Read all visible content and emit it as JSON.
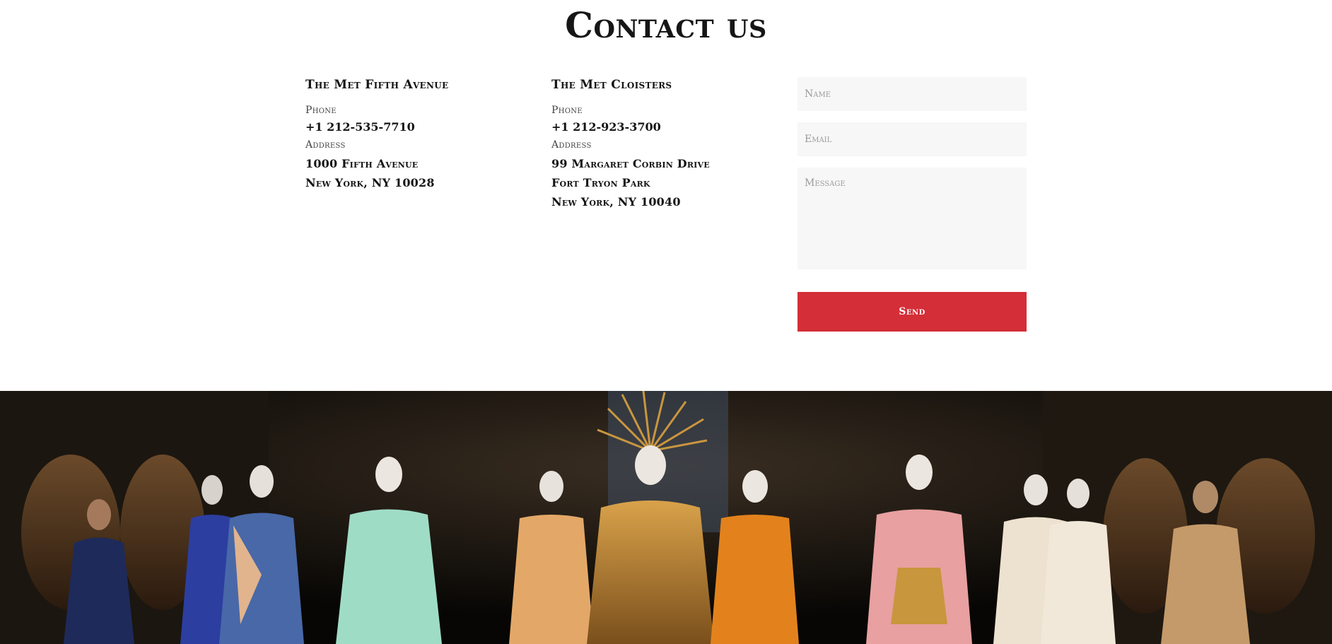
{
  "page": {
    "title": "Contact us"
  },
  "locations": [
    {
      "name": "The Met Fifth Avenue",
      "phone_label": "Phone",
      "phone": "+1 212-535-7710",
      "address_label": "Address",
      "address_lines": [
        "1000 Fifth Avenue",
        "New York, NY 10028"
      ]
    },
    {
      "name": "The Met Cloisters",
      "phone_label": "Phone",
      "phone": "+1 212-923-3700",
      "address_label": "Address",
      "address_lines": [
        "99 Margaret Corbin Drive",
        "Fort Tryon Park",
        "New York, NY 10040"
      ]
    }
  ],
  "form": {
    "name_placeholder": "Name",
    "email_placeholder": "Email",
    "message_placeholder": "Message",
    "send_label": "Send"
  },
  "colors": {
    "accent": "#d42e38",
    "field_bg": "#f7f7f8",
    "text": "#141414"
  }
}
